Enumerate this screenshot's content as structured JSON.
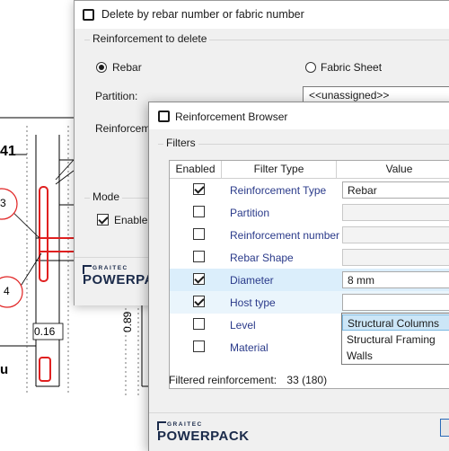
{
  "cad": {
    "labels": [
      "41",
      "3",
      "4",
      "0.16",
      "0.89",
      "u"
    ]
  },
  "delete_dialog": {
    "title": "Delete by rebar number or fabric number",
    "icon": "graitec-app-icon",
    "group_reinforcement": "Reinforcement to delete",
    "radio_rebar": "Rebar",
    "radio_fabric": "Fabric Sheet",
    "partition_label": "Partition:",
    "partition_value": "<<unassigned>>",
    "reinforcement_label": "Reinforcem",
    "group_mode": "Mode",
    "enable_label": "Enable",
    "brand_small": "GRAITEC",
    "brand_big": "POWERPA"
  },
  "browser": {
    "title": "Reinforcement Browser",
    "icon": "graitec-app-icon",
    "filters_label": "Filters",
    "columns": [
      "Enabled",
      "Filter Type",
      "Value"
    ],
    "rows": [
      {
        "type": "Reinforcement Type",
        "enabled": true,
        "value": "Rebar"
      },
      {
        "type": "Partition",
        "enabled": false,
        "value": ""
      },
      {
        "type": "Reinforcement number",
        "enabled": false,
        "value": ""
      },
      {
        "type": "Rebar Shape",
        "enabled": false,
        "value": ""
      },
      {
        "type": "Diameter",
        "enabled": true,
        "value": "8 mm"
      },
      {
        "type": "Host type",
        "enabled": true,
        "value": ""
      },
      {
        "type": "Level",
        "enabled": false,
        "value": ""
      },
      {
        "type": "Material",
        "enabled": false,
        "value": ""
      }
    ],
    "dropdown_options": [
      "Structural Columns",
      "Structural Framing",
      "Walls"
    ],
    "filtered_label": "Filtered reinforcement:",
    "filtered_value": "33 (180)",
    "brand_small": "GRAITEC",
    "brand_big": "POWERPACK"
  },
  "colors": {
    "rebar": "#e02020",
    "selection": "#dbeefb",
    "highlight": "#cce6f7"
  }
}
